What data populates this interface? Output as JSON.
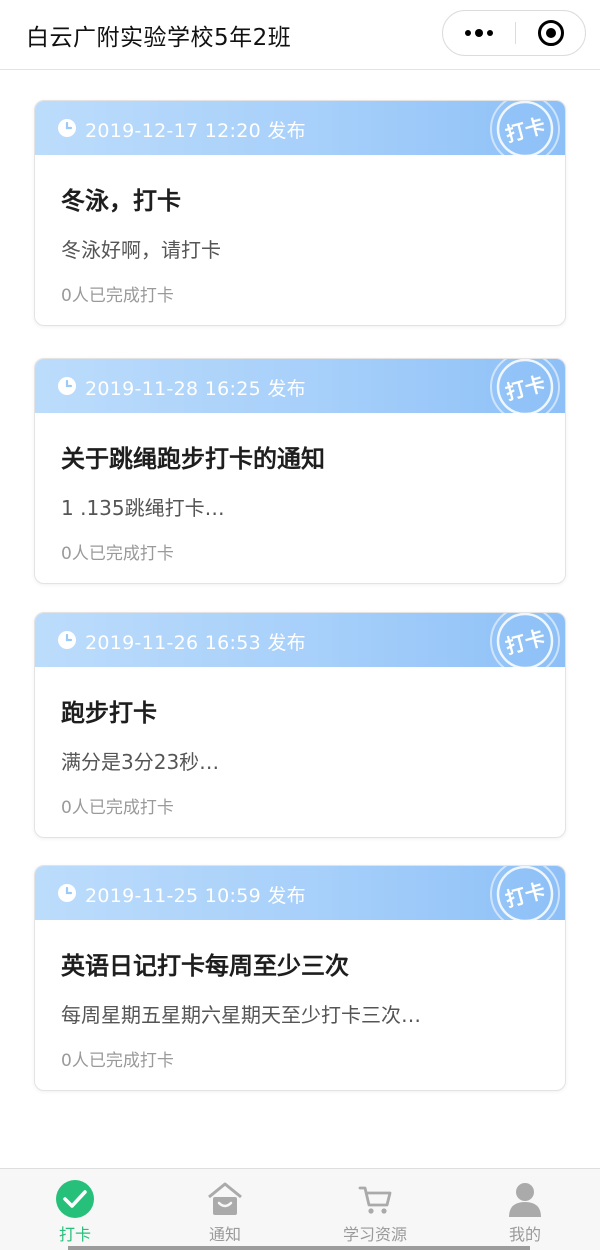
{
  "header": {
    "title": "白云广附实验学校5年2班"
  },
  "capsule": {
    "more_icon": "more-dots-icon",
    "close_icon": "target-close-icon"
  },
  "cards": [
    {
      "date": "2019-12-17 12:20 发布",
      "stamp": "打卡",
      "title": "冬泳，打卡",
      "desc": "冬泳好啊，请打卡",
      "count": "0人已完成打卡"
    },
    {
      "date": "2019-11-28 16:25 发布",
      "stamp": "打卡",
      "title": "关于跳绳跑步打卡的通知",
      "desc": "1 .135跳绳打卡…",
      "count": "0人已完成打卡"
    },
    {
      "date": "2019-11-26 16:53 发布",
      "stamp": "打卡",
      "title": "跑步打卡",
      "desc": "满分是3分23秒…",
      "count": "0人已完成打卡"
    },
    {
      "date": "2019-11-25 10:59 发布",
      "stamp": "打卡",
      "title": "英语日记打卡每周至少三次",
      "desc": "每周星期五星期六星期天至少打卡三次…",
      "count": "0人已完成打卡"
    }
  ],
  "tabs": [
    {
      "label": "打卡",
      "icon": "check-circle-icon",
      "active": true
    },
    {
      "label": "通知",
      "icon": "home-icon",
      "active": false
    },
    {
      "label": "学习资源",
      "icon": "cart-icon",
      "active": false
    },
    {
      "label": "我的",
      "icon": "user-icon",
      "active": false
    }
  ],
  "colors": {
    "accent_green": "#27c07a",
    "card_header_blue": "#a6cffa",
    "tab_inactive": "#9a9a9a"
  }
}
